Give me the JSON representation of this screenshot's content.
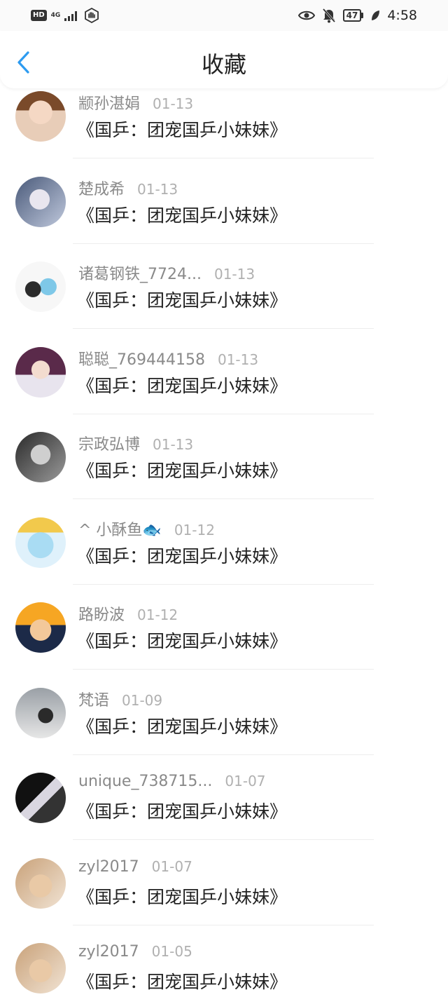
{
  "status_bar": {
    "hd": "HD",
    "network": "4G",
    "battery": "47",
    "time": "4:58"
  },
  "nav": {
    "title": "收藏"
  },
  "items": [
    {
      "user": "颛孙湛娟",
      "date": "01-13",
      "content": "《国乒：团宠国乒小妹妹》"
    },
    {
      "user": "楚成希",
      "date": "01-13",
      "content": "《国乒：团宠国乒小妹妹》"
    },
    {
      "user": "诸葛钢铁_7724...",
      "date": "01-13",
      "content": "《国乒：团宠国乒小妹妹》"
    },
    {
      "user": "聪聪_769444158",
      "date": "01-13",
      "content": "《国乒：团宠国乒小妹妹》"
    },
    {
      "user": "宗政弘博",
      "date": "01-13",
      "content": "《国乒：团宠国乒小妹妹》"
    },
    {
      "user": "^ 小酥鱼🐟",
      "date": "01-12",
      "content": "《国乒：团宠国乒小妹妹》"
    },
    {
      "user": "路盼波",
      "date": "01-12",
      "content": "《国乒：团宠国乒小妹妹》"
    },
    {
      "user": "梵语",
      "date": "01-09",
      "content": "《国乒：团宠国乒小妹妹》"
    },
    {
      "user": "unique_738715...",
      "date": "01-07",
      "content": "《国乒：团宠国乒小妹妹》"
    },
    {
      "user": "zyl2017",
      "date": "01-07",
      "content": "《国乒：团宠国乒小妹妹》"
    },
    {
      "user": "zyl2017",
      "date": "01-05",
      "content": "《国乒：团宠国乒小妹妹》"
    }
  ],
  "colors": {
    "accent": "#2d9bf0",
    "username": "#8a8a8a",
    "date": "#b0b0b0",
    "content": "#222222"
  }
}
